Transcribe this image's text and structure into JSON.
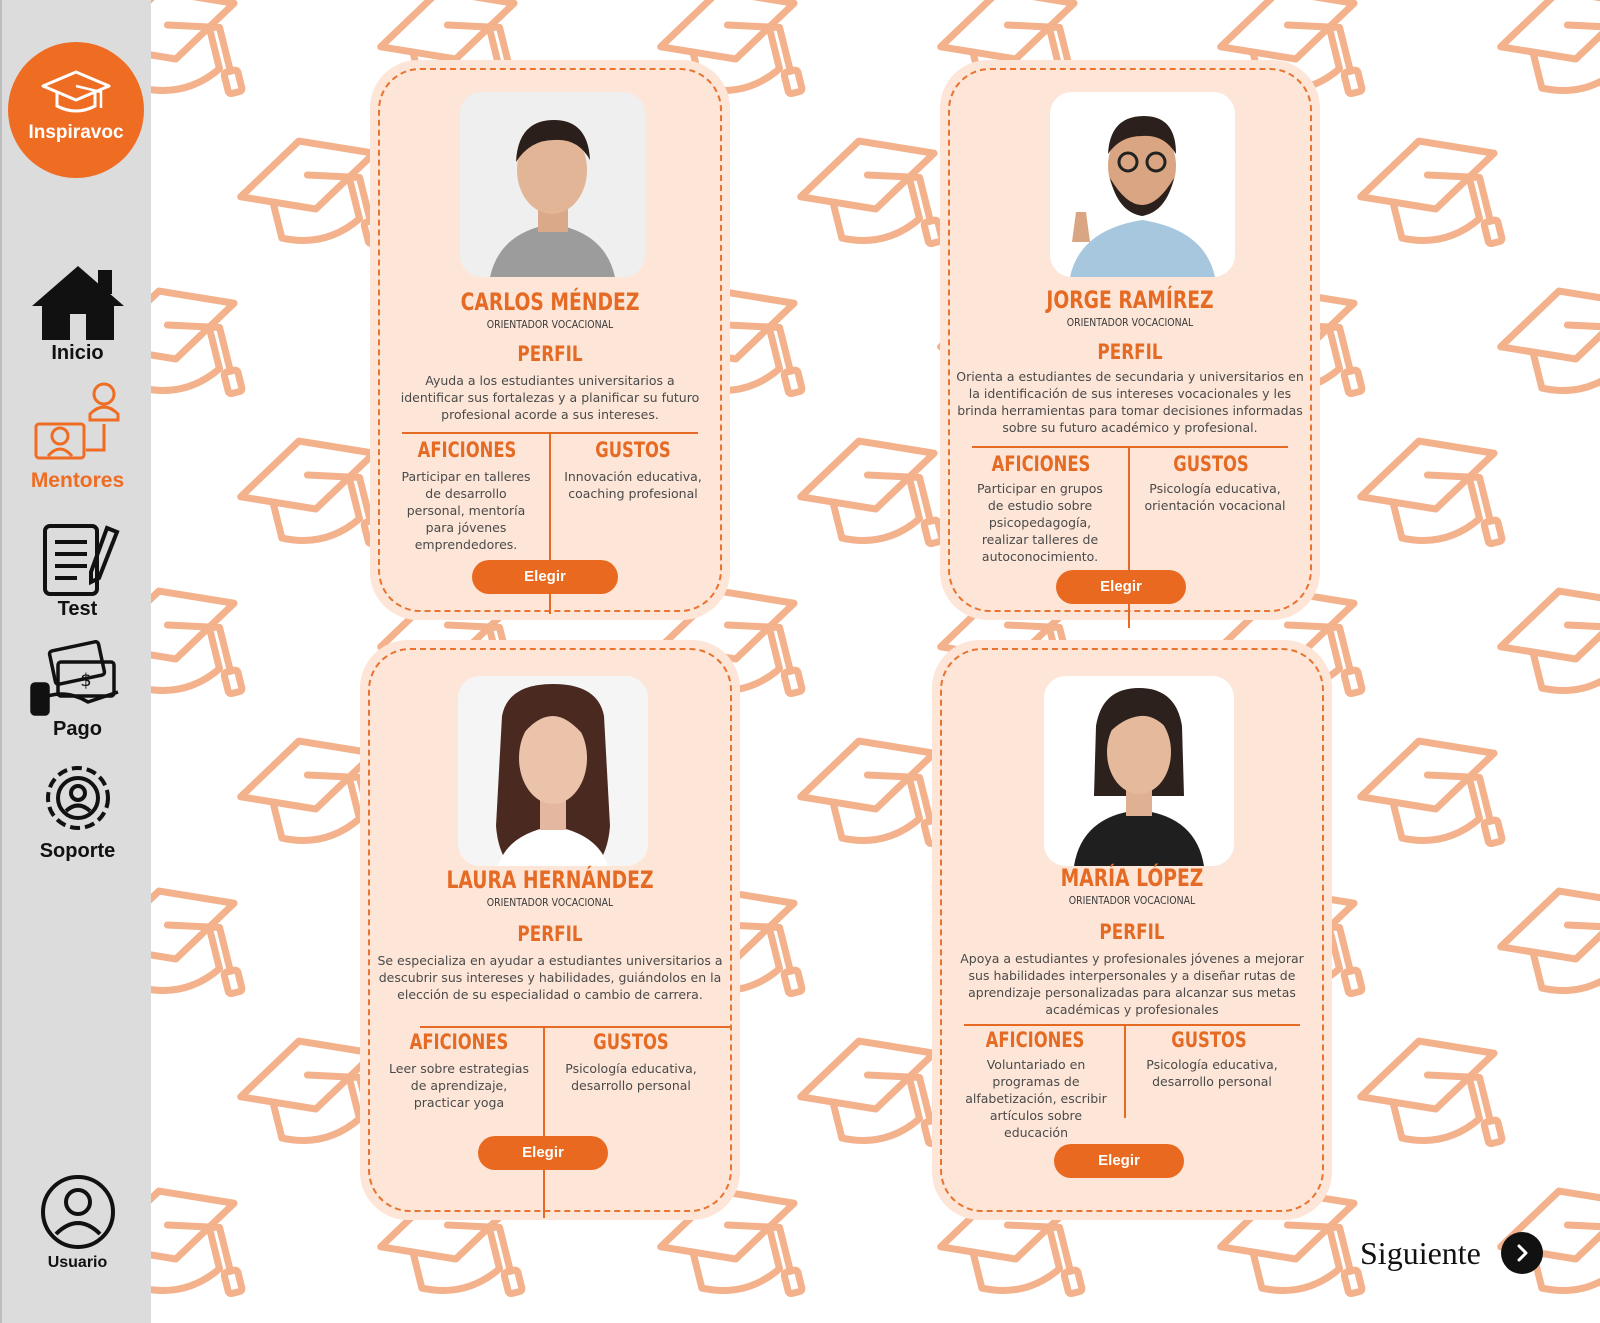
{
  "app": {
    "brand": "Inspiravoc",
    "accent": "#ef6c23"
  },
  "sidebar": {
    "items": [
      {
        "label": "Inicio",
        "icon": "house-icon"
      },
      {
        "label": "Mentores",
        "icon": "mentors-icon",
        "active": true
      },
      {
        "label": "Test",
        "icon": "test-icon"
      },
      {
        "label": "Pago",
        "icon": "payment-icon"
      },
      {
        "label": "Soporte",
        "icon": "support-icon"
      }
    ],
    "user_label": "Usuario"
  },
  "mentors": [
    {
      "name": "CARLOS MÉNDEZ",
      "role": "ORIENTADOR VOCACIONAL",
      "perfil_title": "PERFIL",
      "perfil": "Ayuda a los estudiantes universitarios a identificar sus fortalezas y a planificar su futuro profesional acorde a sus intereses.",
      "aficiones_title": "AFICIONES",
      "aficiones": "Participar en talleres de desarrollo personal, mentoría para jóvenes emprendedores.",
      "gustos_title": "GUSTOS",
      "gustos": "Innovación educativa, coaching profesional",
      "button": "Elegir"
    },
    {
      "name": "JORGE RAMÍREZ",
      "role": "ORIENTADOR VOCACIONAL",
      "perfil_title": "PERFIL",
      "perfil": "Orienta a estudiantes de secundaria y universitarios en la identificación de sus intereses vocacionales y les brinda herramientas para tomar decisiones informadas sobre su futuro académico y profesional.",
      "aficiones_title": "AFICIONES",
      "aficiones": "Participar en grupos de estudio sobre psicopedagogía, realizar talleres de autoconocimiento.",
      "gustos_title": "GUSTOS",
      "gustos": "Psicología educativa, orientación vocacional",
      "button": "Elegir"
    },
    {
      "name": "LAURA HERNÁNDEZ",
      "role": "ORIENTADOR VOCACIONAL",
      "perfil_title": "PERFIL",
      "perfil": "Se especializa en ayudar a estudiantes universitarios a descubrir sus intereses y habilidades, guiándolos en la elección de su especialidad o cambio de carrera.",
      "aficiones_title": "AFICIONES",
      "aficiones": "Leer sobre estrategias de aprendizaje, practicar yoga",
      "gustos_title": "GUSTOS",
      "gustos": "Psicología educativa, desarrollo personal",
      "button": "Elegir"
    },
    {
      "name": "MARÍA LÓPEZ",
      "role": "ORIENTADOR VOCACIONAL",
      "perfil_title": "PERFIL",
      "perfil": "Apoya a estudiantes y profesionales jóvenes a mejorar sus habilidades interpersonales y a diseñar rutas de aprendizaje personalizadas para alcanzar sus metas académicas y profesionales",
      "aficiones_title": "AFICIONES",
      "aficiones": "Voluntariado en programas de alfabetización, escribir artículos sobre educación",
      "gustos_title": "GUSTOS",
      "gustos": "Psicología educativa, desarrollo personal",
      "button": "Elegir"
    }
  ],
  "next_label": "Siguiente"
}
